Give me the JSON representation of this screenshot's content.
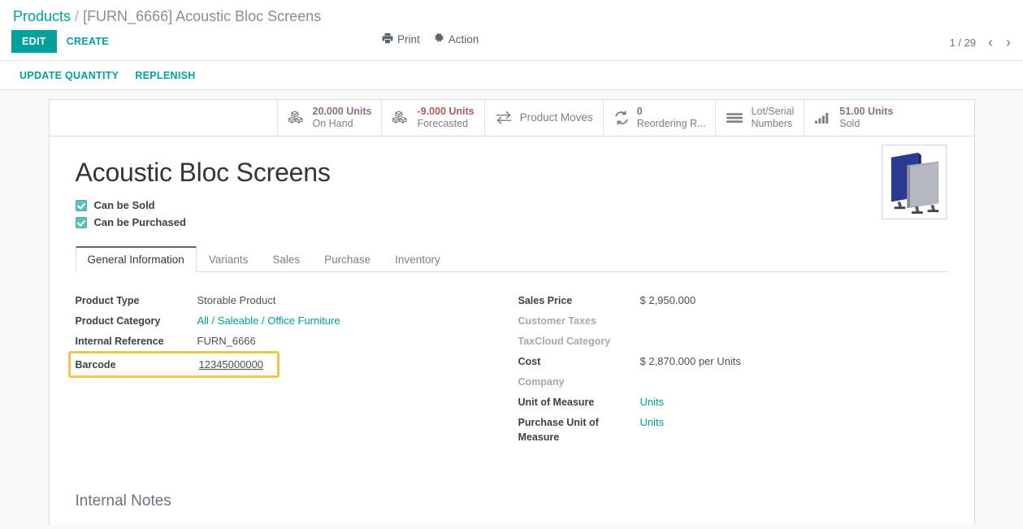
{
  "breadcrumb": {
    "root": "Products",
    "separator": "/",
    "current": "[FURN_6666] Acoustic Bloc Screens"
  },
  "control_panel": {
    "edit_label": "EDIT",
    "create_label": "CREATE",
    "print_label": "Print",
    "print_icon": "printer-icon",
    "action_label": "Action",
    "action_icon": "gear-icon",
    "pager_text": "1 / 29",
    "prev_icon": "‹",
    "next_icon": "›"
  },
  "sub_toolbar": {
    "buttons": [
      {
        "label": "UPDATE QUANTITY"
      },
      {
        "label": "REPLENISH"
      }
    ]
  },
  "stat_buttons": [
    {
      "icon": "cubes-icon",
      "value": "20.000 Units",
      "label": "On Hand",
      "value_tone": "positive"
    },
    {
      "icon": "cubes-icon",
      "value": "-9.000 Units",
      "label": "Forecasted",
      "value_tone": "negative"
    },
    {
      "icon": "exchange-icon",
      "label": "Product Moves",
      "simple": true
    },
    {
      "icon": "refresh-icon",
      "value": "0",
      "label": "Reordering R...",
      "value_tone": "positive"
    },
    {
      "icon": "bars-icon",
      "label_line1": "Lot/Serial",
      "label_line2": "Numbers",
      "two_line": true
    },
    {
      "icon": "bar-chart-icon",
      "value": "51.00 Units",
      "label": "Sold",
      "value_tone": "positive"
    }
  ],
  "product": {
    "title": "Acoustic Bloc Screens",
    "checkboxes": [
      {
        "label": "Can be Sold",
        "checked": true
      },
      {
        "label": "Can be Purchased",
        "checked": true
      }
    ],
    "image_alt": "acoustic-bloc-screens-photo"
  },
  "tabs": [
    {
      "label": "General Information",
      "active": true
    },
    {
      "label": "Variants",
      "active": false
    },
    {
      "label": "Sales",
      "active": false
    },
    {
      "label": "Purchase",
      "active": false
    },
    {
      "label": "Inventory",
      "active": false
    }
  ],
  "fields_left": [
    {
      "label": "Product Type",
      "value": "Storable Product",
      "style": "plain"
    },
    {
      "label": "Product Category",
      "value": "All / Saleable / Office Furniture",
      "style": "link"
    },
    {
      "label": "Internal Reference",
      "value": "FURN_6666",
      "style": "plain"
    },
    {
      "label": "Barcode",
      "value": "12345000000",
      "style": "underlined",
      "highlighted": true
    }
  ],
  "fields_right": [
    {
      "label": "Sales Price",
      "value": "$ 2,950.000",
      "style": "plain",
      "label_muted": false
    },
    {
      "label": "Customer Taxes",
      "value": "",
      "style": "plain",
      "label_muted": true
    },
    {
      "label": "TaxCloud Category",
      "value": "",
      "style": "plain",
      "label_muted": true
    },
    {
      "label": "Cost",
      "value": "$ 2,870.000",
      "suffix": "per Units",
      "style": "plain",
      "label_muted": false
    },
    {
      "label": "Company",
      "value": "",
      "style": "plain",
      "label_muted": true
    },
    {
      "label": "Unit of Measure",
      "value": "Units",
      "style": "link",
      "label_muted": false
    },
    {
      "label": "Purchase Unit of Measure",
      "value": "Units",
      "style": "link",
      "label_muted": false
    }
  ],
  "notes": {
    "title": "Internal Notes"
  },
  "colors": {
    "accent_teal": "#00a09d",
    "stat_value_purple": "#8f6a8f",
    "stat_value_red": "#b55b5b",
    "highlight_gold": "#f1c74b",
    "tab_active_top": "#7c5a88"
  }
}
